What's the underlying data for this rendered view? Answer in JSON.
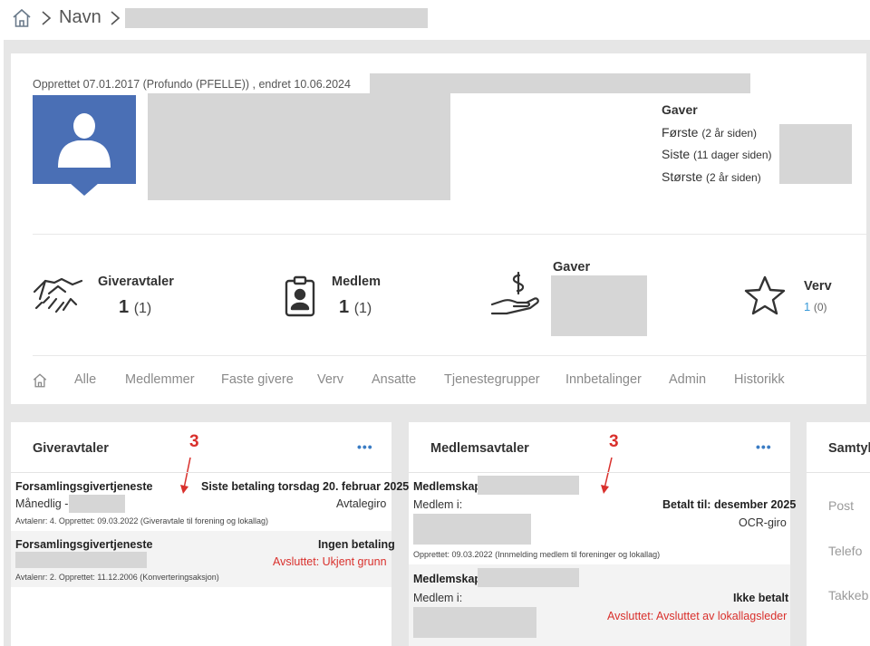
{
  "breadcrumb": {
    "name": "Navn"
  },
  "profile": {
    "created_line": "Opprettet 07.01.2017 (Profundo (PFELLE)) , endret 10.06.2024"
  },
  "gifts_summary": {
    "title": "Gaver",
    "first_label": "Første",
    "first_hint": "(2 år siden)",
    "last_label": "Siste",
    "last_hint": "(11 dager siden)",
    "largest_label": "Største",
    "largest_hint": "(2 år siden)"
  },
  "stats": {
    "giveravtaler": {
      "title": "Giveravtaler",
      "value": "1",
      "paren": "(1)"
    },
    "medlem": {
      "title": "Medlem",
      "value": "1",
      "paren": "(1)"
    },
    "gaver": {
      "title": "Gaver"
    },
    "verv": {
      "title": "Verv",
      "value": "1",
      "paren": "(0)"
    }
  },
  "tabs": [
    "Alle",
    "Medlemmer",
    "Faste givere",
    "Verv",
    "Ansatte",
    "Tjenestegrupper",
    "Innbetalinger",
    "Admin",
    "Historikk"
  ],
  "giveravtaler_card": {
    "title": "Giveravtaler",
    "dots": "•••",
    "annotation": "3",
    "rows": [
      {
        "name": "Forsamlingsgivertjeneste",
        "status": "Siste betaling torsdag 20. februar 2025",
        "freq": "Månedlig -",
        "method": "Avtalegiro",
        "meta": "Avtalenr: 4. Opprettet: 09.03.2022 (Giveravtale til forening og lokallag)"
      },
      {
        "name": "Forsamlingsgivertjeneste",
        "status": "Ingen betaling",
        "end": "Avsluttet: Ukjent grunn",
        "meta": "Avtalenr: 2. Opprettet: 11.12.2006 (Konverteringsaksjon)"
      }
    ]
  },
  "medlemsavtaler_card": {
    "title": "Medlemsavtaler",
    "dots": "•••",
    "annotation": "3",
    "rows": [
      {
        "name": "Medlemskap",
        "member_in": "Medlem i:",
        "paid": "Betalt til: desember 2025",
        "method": "OCR-giro",
        "meta": "Opprettet: 09.03.2022 (Innmelding medlem til foreninger og lokallag)"
      },
      {
        "name": "Medlemskap",
        "member_in": "Medlem i:",
        "paid": "Ikke betalt",
        "end": "Avsluttet: Avsluttet av lokallagsleder"
      }
    ]
  },
  "samtykke_card": {
    "title": "Samtyk",
    "items": [
      "Post",
      "Telefo",
      "Takkeb"
    ]
  },
  "colors": {
    "avatar_blue": "#4a6fb5",
    "link_blue": "#3a9ad9",
    "alert_red": "#d9302c"
  }
}
